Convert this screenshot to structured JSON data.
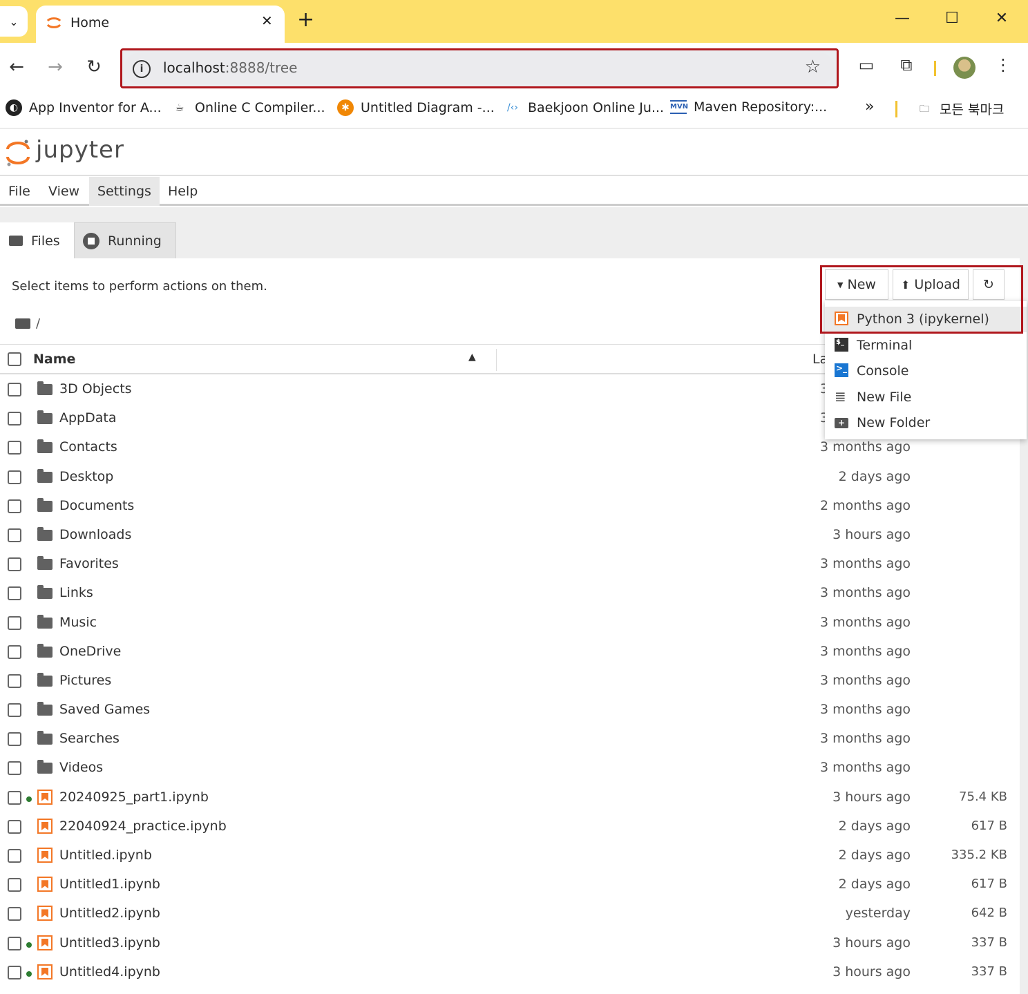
{
  "browser": {
    "tab_title": "Home",
    "url_host": "localhost",
    "url_path": ":8888/tree",
    "bookmarks": [
      {
        "label": "App Inventor for A...",
        "icon": "globe-icon"
      },
      {
        "label": "Online C Compiler...",
        "icon": "coffee-icon"
      },
      {
        "label": "Untitled Diagram -...",
        "icon": "drawio-icon"
      },
      {
        "label": "Baekjoon Online Ju...",
        "icon": "code-icon"
      },
      {
        "label": "Maven Repository:...",
        "icon": "mvn-icon"
      }
    ],
    "more_bookmarks": "»",
    "all_bookmarks": "모든 북마크"
  },
  "jupyter": {
    "logo_text": "jupyter",
    "menu": [
      "File",
      "View",
      "Settings",
      "Help"
    ],
    "tabs": {
      "files": "Files",
      "running": "Running"
    },
    "hint": "Select items to perform actions on them.",
    "breadcrumb": "/",
    "buttons": {
      "new": "New",
      "upload": "Upload"
    },
    "columns": {
      "name": "Name",
      "modified_partial": "La"
    },
    "new_menu": [
      {
        "label": "Python 3 (ipykernel)",
        "icon": "notebook-icon"
      },
      {
        "label": "Terminal",
        "icon": "terminal-icon"
      },
      {
        "label": "Console",
        "icon": "console-icon"
      },
      {
        "label": "New File",
        "icon": "file-text-icon"
      },
      {
        "label": "New Folder",
        "icon": "new-folder-icon"
      }
    ],
    "files": [
      {
        "name": "3D Objects",
        "type": "folder",
        "modified": "3 months ago",
        "size": "",
        "running": false
      },
      {
        "name": "AppData",
        "type": "folder",
        "modified": "3 months ago",
        "size": "",
        "running": false
      },
      {
        "name": "Contacts",
        "type": "folder",
        "modified": "3 months ago",
        "size": "",
        "running": false
      },
      {
        "name": "Desktop",
        "type": "folder",
        "modified": "2 days ago",
        "size": "",
        "running": false
      },
      {
        "name": "Documents",
        "type": "folder",
        "modified": "2 months ago",
        "size": "",
        "running": false
      },
      {
        "name": "Downloads",
        "type": "folder",
        "modified": "3 hours ago",
        "size": "",
        "running": false
      },
      {
        "name": "Favorites",
        "type": "folder",
        "modified": "3 months ago",
        "size": "",
        "running": false
      },
      {
        "name": "Links",
        "type": "folder",
        "modified": "3 months ago",
        "size": "",
        "running": false
      },
      {
        "name": "Music",
        "type": "folder",
        "modified": "3 months ago",
        "size": "",
        "running": false
      },
      {
        "name": "OneDrive",
        "type": "folder",
        "modified": "3 months ago",
        "size": "",
        "running": false
      },
      {
        "name": "Pictures",
        "type": "folder",
        "modified": "3 months ago",
        "size": "",
        "running": false
      },
      {
        "name": "Saved Games",
        "type": "folder",
        "modified": "3 months ago",
        "size": "",
        "running": false
      },
      {
        "name": "Searches",
        "type": "folder",
        "modified": "3 months ago",
        "size": "",
        "running": false
      },
      {
        "name": "Videos",
        "type": "folder",
        "modified": "3 months ago",
        "size": "",
        "running": false
      },
      {
        "name": "20240925_part1.ipynb",
        "type": "notebook",
        "modified": "3 hours ago",
        "size": "75.4 KB",
        "running": true
      },
      {
        "name": "22040924_practice.ipynb",
        "type": "notebook",
        "modified": "2 days ago",
        "size": "617 B",
        "running": false
      },
      {
        "name": "Untitled.ipynb",
        "type": "notebook",
        "modified": "2 days ago",
        "size": "335.2 KB",
        "running": false
      },
      {
        "name": "Untitled1.ipynb",
        "type": "notebook",
        "modified": "2 days ago",
        "size": "617 B",
        "running": false
      },
      {
        "name": "Untitled2.ipynb",
        "type": "notebook",
        "modified": "yesterday",
        "size": "642 B",
        "running": false
      },
      {
        "name": "Untitled3.ipynb",
        "type": "notebook",
        "modified": "3 hours ago",
        "size": "337 B",
        "running": true
      },
      {
        "name": "Untitled4.ipynb",
        "type": "notebook",
        "modified": "3 hours ago",
        "size": "337 B",
        "running": true
      }
    ]
  },
  "colors": {
    "accent": "#f37726",
    "highlight_box": "#b0171d",
    "tabstrip": "#fde06b",
    "running_dot": "#2e7d32"
  }
}
